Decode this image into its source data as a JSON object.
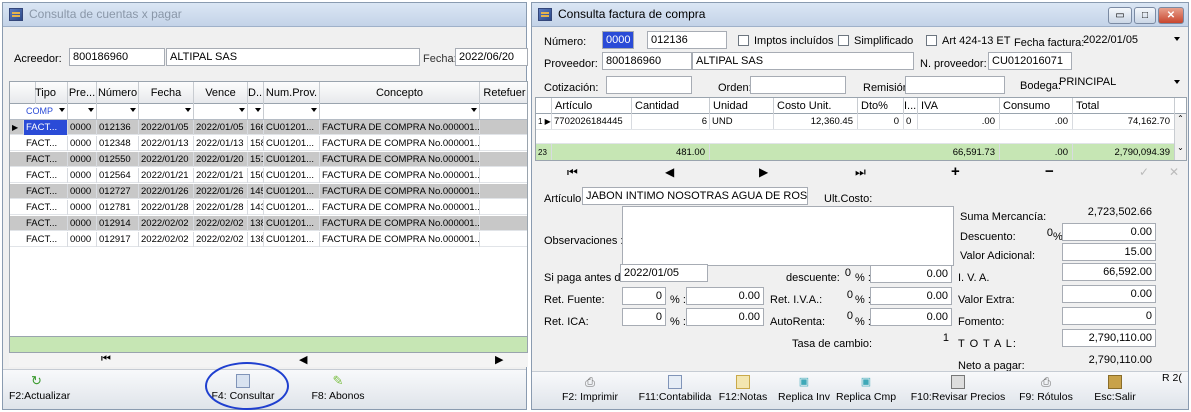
{
  "left_window": {
    "title": "Consulta de cuentas x pagar",
    "acreedor_label": "Acreedor:",
    "acreedor_code": "800186960",
    "acreedor_name": "ALTIPAL SAS",
    "fecha_label": "Fecha:",
    "fecha_value": "2022/06/20",
    "columns": [
      "Tipo",
      "Pre...",
      "Número",
      "Fecha",
      "Vence",
      "D...",
      "Num.Prov.",
      "Concepto",
      "Retefuer"
    ],
    "filter_tipo": "COMP",
    "rows": [
      {
        "tipo": "FACT...",
        "pre": "0000",
        "numero": "012136",
        "fecha": "2022/01/05",
        "vence": "2022/01/05",
        "d": "166",
        "numprov": "CU01201...",
        "concepto": "FACTURA DE COMPRA No.000001..."
      },
      {
        "tipo": "FACT...",
        "pre": "0000",
        "numero": "012348",
        "fecha": "2022/01/13",
        "vence": "2022/01/13",
        "d": "158",
        "numprov": "CU01201...",
        "concepto": "FACTURA DE COMPRA No.000001..."
      },
      {
        "tipo": "FACT...",
        "pre": "0000",
        "numero": "012550",
        "fecha": "2022/01/20",
        "vence": "2022/01/20",
        "d": "151",
        "numprov": "CU01201...",
        "concepto": "FACTURA DE COMPRA No.000001..."
      },
      {
        "tipo": "FACT...",
        "pre": "0000",
        "numero": "012564",
        "fecha": "2022/01/21",
        "vence": "2022/01/21",
        "d": "150",
        "numprov": "CU01201...",
        "concepto": "FACTURA DE COMPRA No.000001..."
      },
      {
        "tipo": "FACT...",
        "pre": "0000",
        "numero": "012727",
        "fecha": "2022/01/26",
        "vence": "2022/01/26",
        "d": "145",
        "numprov": "CU01201...",
        "concepto": "FACTURA DE COMPRA No.000001..."
      },
      {
        "tipo": "FACT...",
        "pre": "0000",
        "numero": "012781",
        "fecha": "2022/01/28",
        "vence": "2022/01/28",
        "d": "143",
        "numprov": "CU01201...",
        "concepto": "FACTURA DE COMPRA No.000001..."
      },
      {
        "tipo": "FACT...",
        "pre": "0000",
        "numero": "012914",
        "fecha": "2022/02/02",
        "vence": "2022/02/02",
        "d": "138",
        "numprov": "CU01201...",
        "concepto": "FACTURA DE COMPRA No.000001..."
      },
      {
        "tipo": "FACT...",
        "pre": "0000",
        "numero": "012917",
        "fecha": "2022/02/02",
        "vence": "2022/02/02",
        "d": "138",
        "numprov": "CU01201...",
        "concepto": "FACTURA DE COMPRA No.000001..."
      }
    ],
    "footer": {
      "refresh": "F2:Actualizar",
      "consult": "F4: Consultar",
      "abonos": "F8: Abonos"
    }
  },
  "right_window": {
    "title": "Consulta factura de compra",
    "numero_label": "Número:",
    "numero_prefix": "0000",
    "numero_value": "012136",
    "impuestos_label": "Imptos incluídos",
    "simplificado_label": "Simplificado",
    "art_label": "Art 424-13 ET",
    "fecha_factura_label": "Fecha factura:",
    "fecha_factura_value": "2022/01/05",
    "proveedor_label": "Proveedor:",
    "proveedor_code": "800186960",
    "proveedor_name": "ALTIPAL SAS",
    "n_proveedor_label": "N. proveedor:",
    "n_proveedor_value": "CU012016071",
    "cotizacion_label": "Cotización:",
    "orden_label": "Orden:",
    "remision_label": "Remisión:",
    "bodega_label": "Bodega:",
    "bodega_value": "PRINCIPAL",
    "columns": [
      "Artículo",
      "Cantidad",
      "Unidad",
      "Costo Unit.",
      "Dto%",
      "I...",
      "IVA",
      "Consumo",
      "Total"
    ],
    "item": {
      "row_no": "1",
      "articulo": "7702026184445",
      "cantidad": "6",
      "unidad": "UND",
      "costo": "12,360.45",
      "dto": "0",
      "i": "0",
      "iva": ".00",
      "consumo": ".00",
      "total": "74,162.70"
    },
    "totals": {
      "row_no": "23",
      "cantidad": "481.00",
      "iva": "66,591.73",
      "consumo": ".00",
      "total": "2,790,094.39"
    },
    "articulo_label": "Artículo:",
    "articulo_value": "JABON INTIMO NOSOTRAS AGUA DE ROSAS X 2",
    "ult_costo_label": "Ult.Costo:",
    "observaciones_label": "Observaciones :",
    "si_paga_label": "Si paga antes de:",
    "si_paga_value": "2022/01/05",
    "descuente_label": "descuente:",
    "descuente_pct": "0",
    "descuente_val": "0.00",
    "ret_fuente_label": "Ret. Fuente:",
    "ret_fuente_pct": "0",
    "ret_fuente_val": "0.00",
    "ret_iva_label": "Ret. I.V.A.:",
    "ret_iva_pct": "0",
    "ret_iva_val": "0.00",
    "ret_ica_label": "Ret. ICA:",
    "ret_ica_pct": "0",
    "ret_ica_val": "0.00",
    "autorenta_label": "AutoRenta:",
    "autorenta_pct": "0",
    "autorenta_val": "0.00",
    "tasa_label": "Tasa de cambio:",
    "tasa_value": "1",
    "pct_sign": "%",
    "pct_colon": "% :",
    "summary": {
      "suma_label": "Suma Mercancía:",
      "suma_value": "2,723,502.66",
      "descuento_label": "Descuento:",
      "descuento_pct": "0",
      "descuento_value": "0.00",
      "valor_adicional_label": "Valor Adicional:",
      "valor_adicional_value": "15.00",
      "iva_label": "I. V. A.",
      "iva_value": "66,592.00",
      "valor_extra_label": "Valor Extra:",
      "valor_extra_value": "0.00",
      "fomento_label": "Fomento:",
      "fomento_value": "0",
      "total_label": "T O T A L:",
      "total_value": "2,790,110.00",
      "neto_label": "Neto a pagar:",
      "neto_value": "2,790,110.00"
    },
    "toolbar": {
      "imprimir": "F2: Imprimir",
      "contabilidad": "F11:Contabilida",
      "notas": "F12:Notas",
      "replica_inv": "Replica Inv",
      "replica_cmp": "Replica Cmp",
      "revisar": "F10:Revisar Precios",
      "rotulos": "F9: Rótulos",
      "salir": "Esc:Salir",
      "cut_text": "R 2("
    }
  },
  "colors": {
    "selection": "#2a4bd7",
    "highlight_circle": "#1f3fcf",
    "totals_row": "#c6e6b4",
    "alt_row": "#c8c8c8"
  }
}
